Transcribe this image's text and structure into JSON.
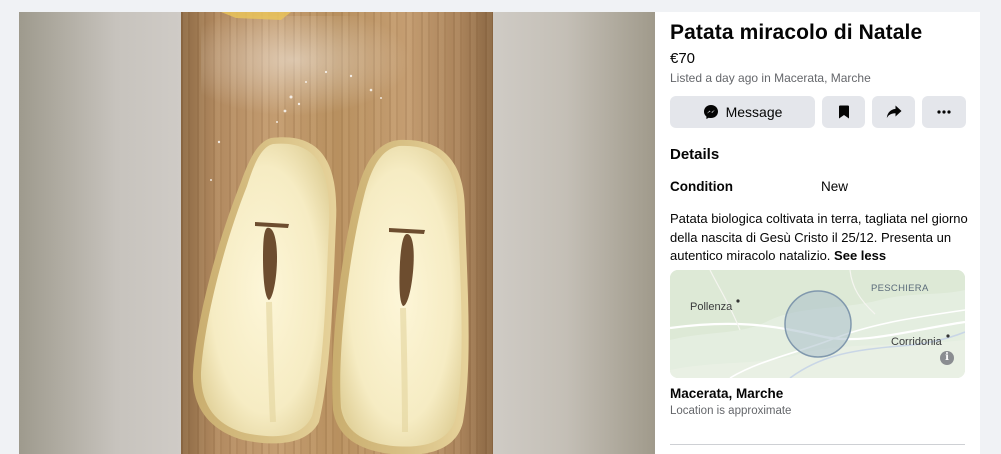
{
  "listing": {
    "title": "Patata miracolo di Natale",
    "price": "€70",
    "listed": "Listed a day ago in Macerata, Marche"
  },
  "actions": {
    "message_label": "Message",
    "message_icon": "messenger-icon",
    "save_icon": "bookmark-icon",
    "share_icon": "share-arrow-icon",
    "more_icon": "more-dots-icon"
  },
  "details": {
    "heading": "Details",
    "condition_label": "Condition",
    "condition_value": "New",
    "description": "Patata biologica coltivata in terra, tagliata nel giorno della nascita di Gesù Cristo il 25/12. Presenta un autentico miracolo natalizio.",
    "see_less": "See less"
  },
  "map": {
    "labels": {
      "pollenza": "Pollenza",
      "peschiera": "PESCHIERA",
      "corridonia": "Corridonia"
    },
    "info_icon": "info-icon"
  },
  "location": {
    "name": "Macerata, Marche",
    "note": "Location is approximate"
  },
  "colors": {
    "button_bg": "#e4e6eb",
    "secondary_text": "#65676b",
    "map_bg": "#e6efe1",
    "radius_fill": "#a9bfca"
  }
}
